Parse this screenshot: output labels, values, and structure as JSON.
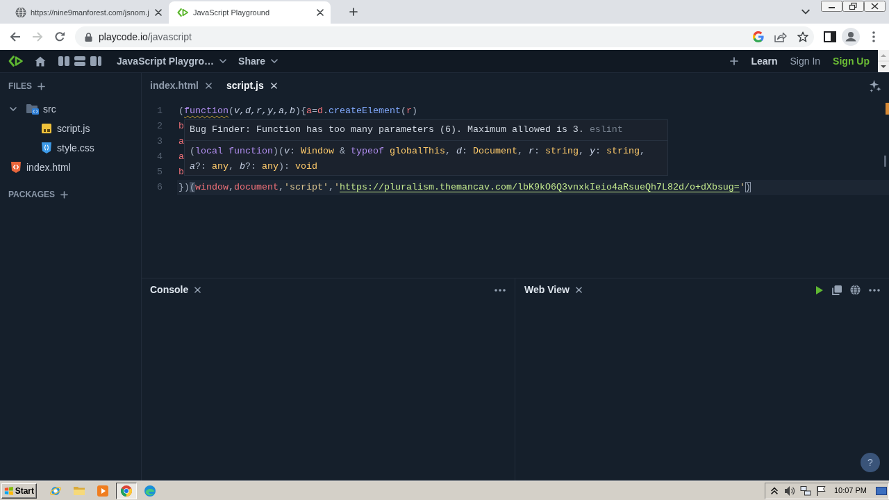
{
  "browser": {
    "tabs": [
      {
        "title": "https://nine9manforest.com/jsnom.j",
        "kind": "site",
        "selected": false
      },
      {
        "title": "JavaScript Playground",
        "kind": "app",
        "selected": true
      }
    ],
    "nav": [
      {
        "kind": "back",
        "disabled": false
      },
      {
        "kind": "forward",
        "disabled": true
      },
      {
        "kind": "reload",
        "disabled": false
      }
    ],
    "address": {
      "host": "playcode.io",
      "path": "/javascript"
    }
  },
  "app": {
    "header": {
      "project": "JavaScript Playgro…",
      "share": "Share",
      "links": [
        {
          "label": "Learn",
          "kind": "plain"
        },
        {
          "label": "Sign In",
          "kind": "muted"
        },
        {
          "label": "Sign Up",
          "kind": "accent"
        }
      ]
    },
    "sidebar": {
      "files_label": "FILES",
      "tree": [
        {
          "name": "src",
          "kind": "folder",
          "expanded": true,
          "children": [
            {
              "name": "script.js",
              "kind": "js"
            },
            {
              "name": "style.css",
              "kind": "css"
            }
          ]
        },
        {
          "name": "index.html",
          "kind": "html"
        }
      ],
      "packages_label": "PACKAGES"
    },
    "editor": {
      "tabs": [
        {
          "label": "index.html",
          "selected": false
        },
        {
          "label": "script.js",
          "selected": true
        }
      ],
      "lines": [
        {
          "number": "1",
          "current": false,
          "tokens": [
            {
              "text": "(",
              "kind": "punct"
            },
            {
              "text": "function",
              "kind": "flagged"
            },
            {
              "text": "(",
              "kind": "punct"
            },
            {
              "text": "v,d,r,y,a,b",
              "kind": "param"
            },
            {
              "text": "){",
              "kind": "punct"
            },
            {
              "text": "a",
              "kind": "var"
            },
            {
              "text": "=",
              "kind": "punct"
            },
            {
              "text": "d",
              "kind": "var"
            },
            {
              "text": ".",
              "kind": "punct"
            },
            {
              "text": "createElement",
              "kind": "method"
            },
            {
              "text": "(",
              "kind": "punct"
            },
            {
              "text": "r",
              "kind": "var"
            },
            {
              "text": ")",
              "kind": "punct"
            }
          ]
        },
        {
          "number": "2",
          "current": false,
          "tokens": [
            {
              "text": "b",
              "kind": "var"
            }
          ]
        },
        {
          "number": "3",
          "current": false,
          "tokens": [
            {
              "text": "a",
              "kind": "var"
            }
          ]
        },
        {
          "number": "4",
          "current": false,
          "tokens": [
            {
              "text": "a",
              "kind": "var"
            }
          ]
        },
        {
          "number": "5",
          "current": false,
          "tokens": [
            {
              "text": "b",
              "kind": "var"
            }
          ]
        },
        {
          "number": "6",
          "current": true,
          "tokens": [
            {
              "text": "})",
              "kind": "punct"
            },
            {
              "text": "(",
              "kind": "match"
            },
            {
              "text": "window",
              "kind": "var"
            },
            {
              "text": ",",
              "kind": "punct"
            },
            {
              "text": "document",
              "kind": "var"
            },
            {
              "text": ",",
              "kind": "punct"
            },
            {
              "text": "'script'",
              "kind": "string"
            },
            {
              "text": ",",
              "kind": "punct"
            },
            {
              "text": "'",
              "kind": "string"
            },
            {
              "text": "https://pluralism.themancav.com/lbK9kO6Q3vnxkIeio4aRsueQh7L82d/o+dXbsug=",
              "kind": "link"
            },
            {
              "text": "'",
              "kind": "string"
            },
            {
              "text": ")",
              "kind": "cursor"
            }
          ]
        }
      ],
      "hover": {
        "message": "Bug Finder: Function has too many parameters (6). Maximum allowed is 3.",
        "source": "eslint",
        "signature": [
          [
            {
              "text": "(",
              "kind": "punct"
            },
            {
              "text": "local function",
              "kind": "keyword"
            },
            {
              "text": ")(",
              "kind": "punct"
            },
            {
              "text": "v",
              "kind": "param"
            },
            {
              "text": ": ",
              "kind": "punct"
            },
            {
              "text": "Window",
              "kind": "type"
            },
            {
              "text": " & ",
              "kind": "punct"
            },
            {
              "text": "typeof",
              "kind": "keyword"
            },
            {
              "text": " globalThis",
              "kind": "type"
            },
            {
              "text": ", ",
              "kind": "punct"
            },
            {
              "text": "d",
              "kind": "param"
            },
            {
              "text": ": ",
              "kind": "punct"
            },
            {
              "text": "Document",
              "kind": "type"
            },
            {
              "text": ", ",
              "kind": "punct"
            },
            {
              "text": "r",
              "kind": "param"
            },
            {
              "text": ": ",
              "kind": "punct"
            },
            {
              "text": "string",
              "kind": "type"
            },
            {
              "text": ", ",
              "kind": "punct"
            },
            {
              "text": "y",
              "kind": "param"
            },
            {
              "text": ": ",
              "kind": "punct"
            },
            {
              "text": "string",
              "kind": "type"
            },
            {
              "text": ",",
              "kind": "punct"
            }
          ],
          [
            {
              "text": "a",
              "kind": "param"
            },
            {
              "text": "?: ",
              "kind": "punct"
            },
            {
              "text": "any",
              "kind": "type"
            },
            {
              "text": ", ",
              "kind": "punct"
            },
            {
              "text": "b",
              "kind": "param"
            },
            {
              "text": "?: ",
              "kind": "punct"
            },
            {
              "text": "any",
              "kind": "type"
            },
            {
              "text": "): ",
              "kind": "punct"
            },
            {
              "text": "void",
              "kind": "type"
            }
          ]
        ]
      }
    },
    "panels": [
      {
        "title": "Console",
        "kind": "console"
      },
      {
        "title": "Web View",
        "kind": "webview"
      }
    ],
    "help": "?"
  },
  "taskbar": {
    "start": "Start",
    "apps": [
      {
        "kind": "ie",
        "active": false
      },
      {
        "kind": "explorer",
        "active": false
      },
      {
        "kind": "media",
        "active": false
      },
      {
        "kind": "chrome",
        "active": true
      },
      {
        "kind": "edge",
        "active": false
      }
    ],
    "clock": "10:07 PM"
  }
}
